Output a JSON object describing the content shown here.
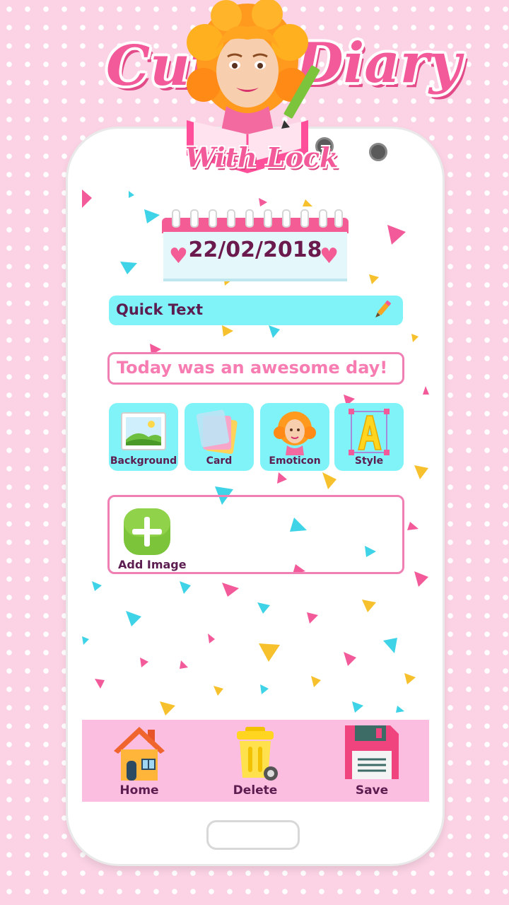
{
  "logo": {
    "word_left": "Cute",
    "word_right": "Diary",
    "subtitle": "With Lock"
  },
  "diary": {
    "date": "22/02/2018",
    "quick_text_label": "Quick Text",
    "entry_text": "Today was an awesome day!"
  },
  "tools": [
    {
      "label": "Background",
      "icon": "landscape-picture-icon"
    },
    {
      "label": "Card",
      "icon": "cards-stack-icon"
    },
    {
      "label": "Emoticon",
      "icon": "girl-avatar-icon"
    },
    {
      "label": "Style",
      "icon": "letter-a-style-icon"
    }
  ],
  "add_image": {
    "label": "Add Image",
    "icon": "plus-icon"
  },
  "bottom_nav": [
    {
      "label": "Home",
      "icon": "house-icon"
    },
    {
      "label": "Delete",
      "icon": "trash-bin-icon"
    },
    {
      "label": "Save",
      "icon": "floppy-disk-icon"
    }
  ],
  "colors": {
    "pink_accent": "#f45c96",
    "cyan_panel": "#7ff3f7",
    "text_dark": "#5c1d50",
    "bottom_bar": "#fbbde0"
  }
}
